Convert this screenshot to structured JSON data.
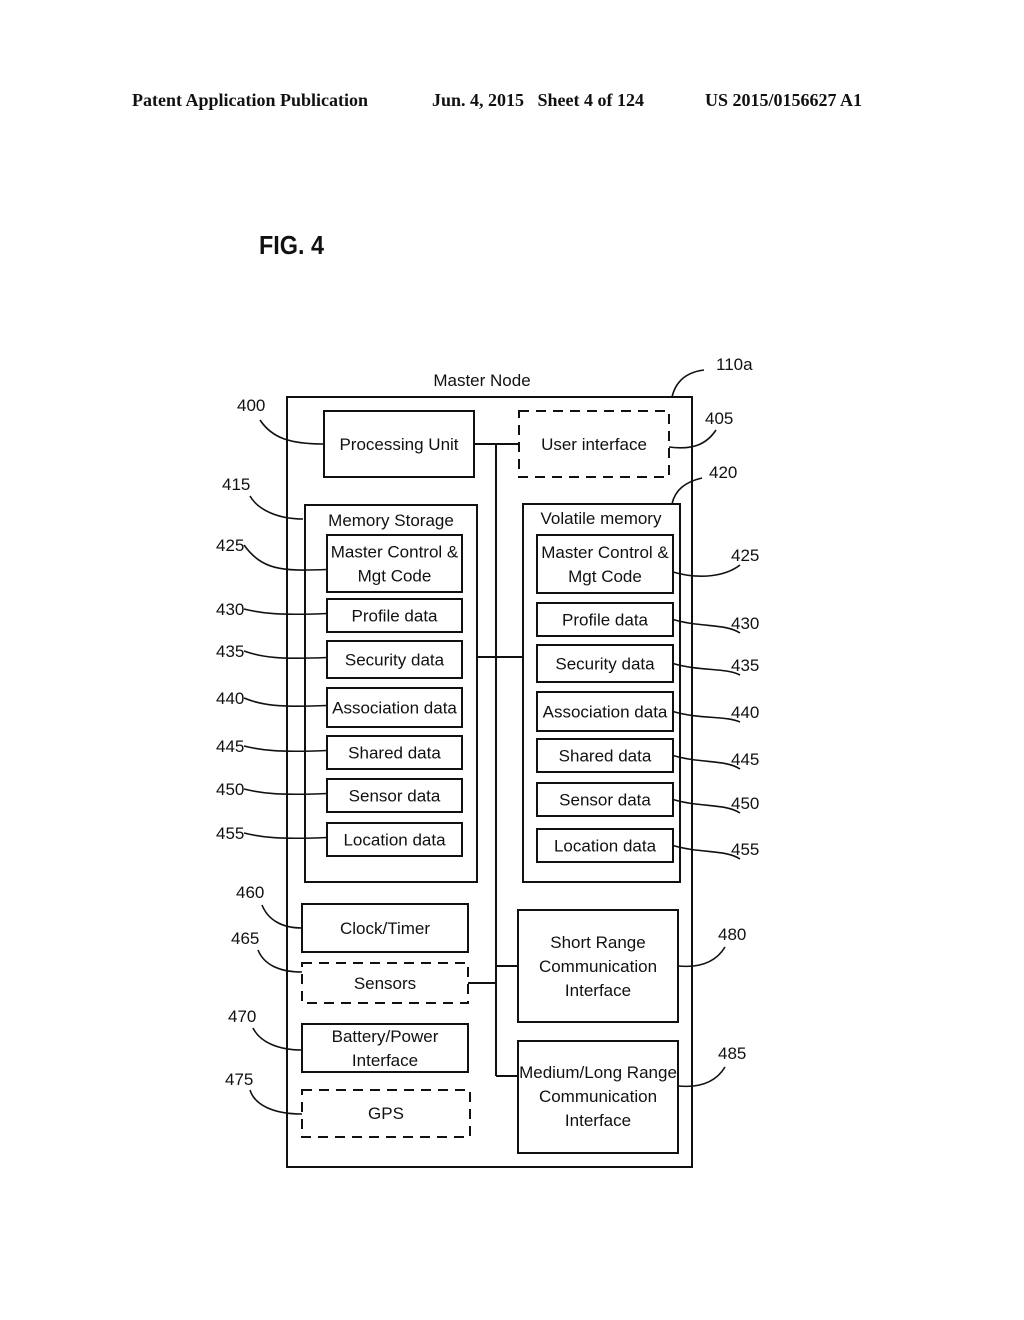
{
  "header": {
    "publication": "Patent Application Publication",
    "date_sheet": "Jun. 4, 2015   Sheet 4 of 124",
    "number": "US 2015/0156627 A1"
  },
  "figure": {
    "title": "FIG. 4",
    "master_node": {
      "label": "Master Node",
      "ref": "110a"
    },
    "processing_unit": {
      "label": "Processing Unit",
      "ref": "400"
    },
    "user_interface": {
      "label": "User interface",
      "ref": "405",
      "optional": true
    },
    "memory_storage": {
      "label": "Memory Storage",
      "ref": "415",
      "items": [
        {
          "lines": [
            "Master Control &",
            "Mgt Code"
          ],
          "ref": "425"
        },
        {
          "lines": [
            "Profile data"
          ],
          "ref": "430"
        },
        {
          "lines": [
            "Security data"
          ],
          "ref": "435"
        },
        {
          "lines": [
            "Association data"
          ],
          "ref": "440"
        },
        {
          "lines": [
            "Shared data"
          ],
          "ref": "445"
        },
        {
          "lines": [
            "Sensor data"
          ],
          "ref": "450"
        },
        {
          "lines": [
            "Location data"
          ],
          "ref": "455"
        }
      ]
    },
    "volatile_memory": {
      "label": "Volatile memory",
      "ref": "420",
      "items": [
        {
          "lines": [
            "Master Control &",
            "Mgt Code"
          ],
          "ref": "425"
        },
        {
          "lines": [
            "Profile data"
          ],
          "ref": "430"
        },
        {
          "lines": [
            "Security data"
          ],
          "ref": "435"
        },
        {
          "lines": [
            "Association data"
          ],
          "ref": "440"
        },
        {
          "lines": [
            "Shared data"
          ],
          "ref": "445"
        },
        {
          "lines": [
            "Sensor data"
          ],
          "ref": "450"
        },
        {
          "lines": [
            "Location data"
          ],
          "ref": "455"
        }
      ]
    },
    "clock_timer": {
      "label": "Clock/Timer",
      "ref": "460"
    },
    "sensors": {
      "label": "Sensors",
      "ref": "465",
      "optional": true
    },
    "battery": {
      "lines": [
        "Battery/Power",
        "Interface"
      ],
      "ref": "470"
    },
    "gps": {
      "label": "GPS",
      "ref": "475",
      "optional": true
    },
    "short_range": {
      "lines": [
        "Short Range",
        "Communication",
        "Interface"
      ],
      "ref": "480"
    },
    "medium_long_range": {
      "lines": [
        "Medium/Long Range",
        "Communication",
        "Interface"
      ],
      "ref": "485"
    }
  }
}
